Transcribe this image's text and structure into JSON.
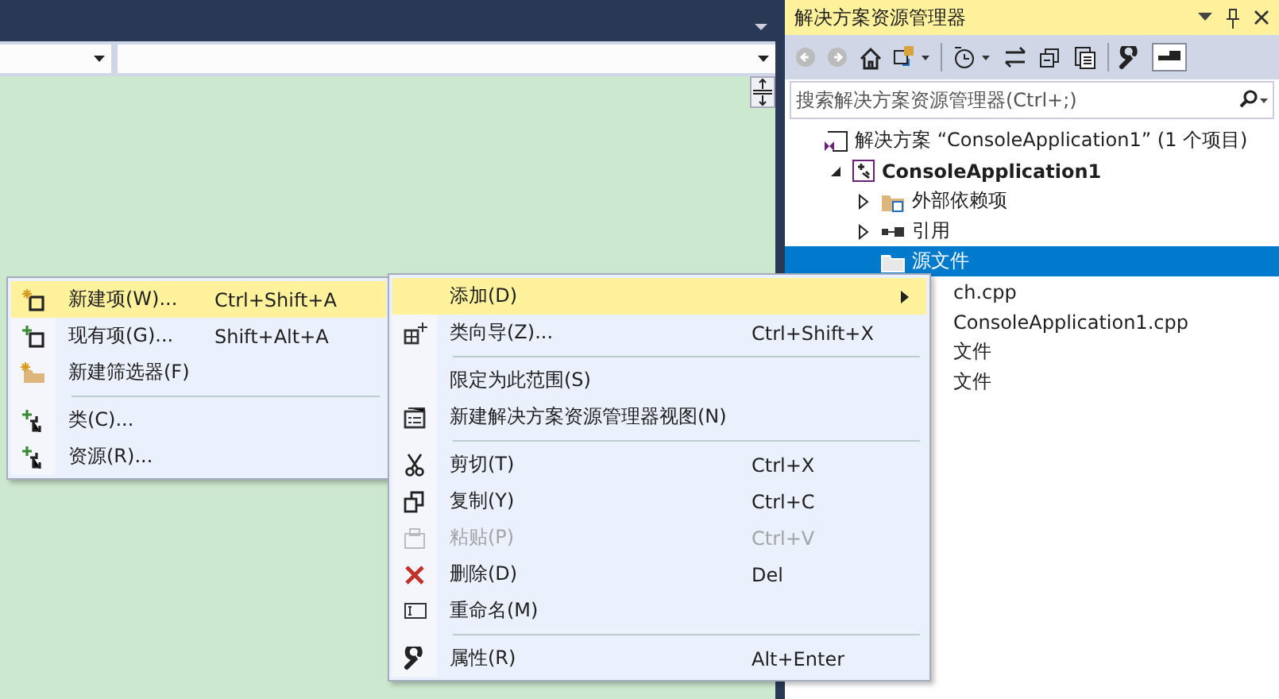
{
  "solution_explorer": {
    "title": "解决方案资源管理器",
    "search": {
      "placeholder": "搜索解决方案资源管理器(Ctrl+;)"
    },
    "tree": [
      {
        "label": "解决方案 “ConsoleApplication1” (1 个项目)",
        "bold": false,
        "selected": false,
        "covered": false,
        "children": [
          {
            "label": "ConsoleApplication1",
            "bold": true,
            "selected": false,
            "covered": false,
            "expanded": true,
            "children": [
              {
                "label": "外部依赖项",
                "bold": false,
                "selected": false,
                "covered": false,
                "expanded": false
              },
              {
                "label": "引用",
                "bold": false,
                "selected": false,
                "covered": false,
                "expanded": false
              },
              {
                "label": "源文件",
                "bold": false,
                "selected": true,
                "covered": false
              },
              {
                "label": "ch.cpp",
                "bold": false,
                "selected": false,
                "covered": true
              },
              {
                "label": "ConsoleApplication1.cpp",
                "bold": false,
                "selected": false,
                "covered": true
              },
              {
                "label": "文件",
                "bold": false,
                "selected": false,
                "covered": true
              },
              {
                "label": "文件",
                "bold": false,
                "selected": false,
                "covered": true
              }
            ]
          }
        ]
      }
    ]
  },
  "context_menu": [
    {
      "kind": "item",
      "label": "添加(D)",
      "submenu": true,
      "selected": true,
      "disabled": false
    },
    {
      "kind": "item",
      "label": "类向导(Z)...",
      "shortcut": "Ctrl+Shift+X",
      "submenu": false,
      "selected": false,
      "disabled": false
    },
    {
      "kind": "separator"
    },
    {
      "kind": "item",
      "label": "限定为此范围(S)",
      "submenu": false,
      "selected": false,
      "disabled": false
    },
    {
      "kind": "item",
      "label": "新建解决方案资源管理器视图(N)",
      "submenu": false,
      "selected": false,
      "disabled": false
    },
    {
      "kind": "separator"
    },
    {
      "kind": "item",
      "label": "剪切(T)",
      "shortcut": "Ctrl+X",
      "submenu": false,
      "selected": false,
      "disabled": false
    },
    {
      "kind": "item",
      "label": "复制(Y)",
      "shortcut": "Ctrl+C",
      "submenu": false,
      "selected": false,
      "disabled": false
    },
    {
      "kind": "item",
      "label": "粘贴(P)",
      "shortcut": "Ctrl+V",
      "submenu": false,
      "selected": false,
      "disabled": true
    },
    {
      "kind": "item",
      "label": "删除(D)",
      "shortcut": "Del",
      "submenu": false,
      "selected": false,
      "disabled": false
    },
    {
      "kind": "item",
      "label": "重命名(M)",
      "submenu": false,
      "selected": false,
      "disabled": false
    },
    {
      "kind": "separator"
    },
    {
      "kind": "item",
      "label": "属性(R)",
      "shortcut": "Alt+Enter",
      "submenu": false,
      "selected": false,
      "disabled": false
    }
  ],
  "add_submenu": [
    {
      "kind": "item",
      "label": "新建项(W)...",
      "shortcut": "Ctrl+Shift+A",
      "selected": true
    },
    {
      "kind": "item",
      "label": "现有项(G)...",
      "shortcut": "Shift+Alt+A",
      "selected": false
    },
    {
      "kind": "item",
      "label": "新建筛选器(F)",
      "selected": false
    },
    {
      "kind": "separator"
    },
    {
      "kind": "item",
      "label": "类(C)...",
      "selected": false
    },
    {
      "kind": "item",
      "label": "资源(R)...",
      "selected": false
    }
  ]
}
